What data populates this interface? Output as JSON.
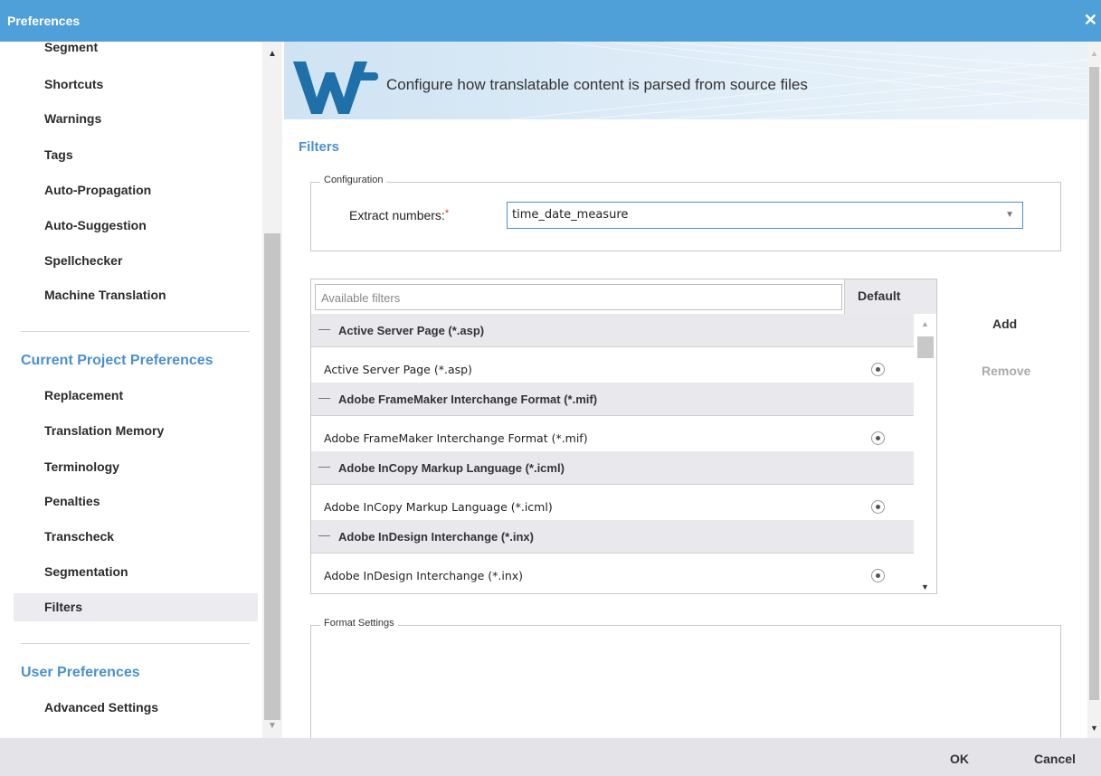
{
  "window": {
    "title": "Preferences",
    "close_icon": "close-icon"
  },
  "sidebar": {
    "items_top": [
      {
        "label": "Segment"
      },
      {
        "label": "Shortcuts"
      },
      {
        "label": "Warnings"
      },
      {
        "label": "Tags"
      },
      {
        "label": "Auto-Propagation"
      },
      {
        "label": "Auto-Suggestion"
      },
      {
        "label": "Spellchecker"
      },
      {
        "label": "Machine Translation"
      }
    ],
    "project_section": "Current Project Preferences",
    "project_items": [
      {
        "label": "Replacement"
      },
      {
        "label": "Translation Memory"
      },
      {
        "label": "Terminology"
      },
      {
        "label": "Penalties"
      },
      {
        "label": "Transcheck"
      },
      {
        "label": "Segmentation"
      },
      {
        "label": "Filters"
      }
    ],
    "selected": "Filters",
    "user_section": "User Preferences",
    "user_items": [
      {
        "label": "Advanced Settings"
      }
    ]
  },
  "banner": {
    "logo": "wf-logo",
    "heading": "Configure how translatable content is parsed from source files"
  },
  "main": {
    "title": "Filters",
    "configuration": {
      "legend": "Configuration",
      "extract_label": "Extract numbers:",
      "required_mark": "*",
      "extract_value": "time_date_measure"
    },
    "filters": {
      "placeholder": "Available filters",
      "default_header": "Default",
      "groups": [
        {
          "group": "Active Server Page (*.asp)",
          "item": "Active Server Page (*.asp)"
        },
        {
          "group": "Adobe FrameMaker Interchange Format (*.mif)",
          "item": "Adobe FrameMaker Interchange Format (*.mif)"
        },
        {
          "group": "Adobe InCopy Markup Language (*.icml)",
          "item": "Adobe InCopy Markup Language (*.icml)"
        },
        {
          "group": "Adobe InDesign Interchange (*.inx)",
          "item": "Adobe InDesign Interchange (*.inx)"
        }
      ]
    },
    "add_label": "Add",
    "remove_label": "Remove",
    "format_settings": {
      "legend": "Format Settings"
    }
  },
  "footer": {
    "ok_label": "OK",
    "cancel_label": "Cancel"
  },
  "colors": {
    "titlebar": "#4f9fd8",
    "accent": "#4a90d0",
    "required": "#dd3333"
  }
}
